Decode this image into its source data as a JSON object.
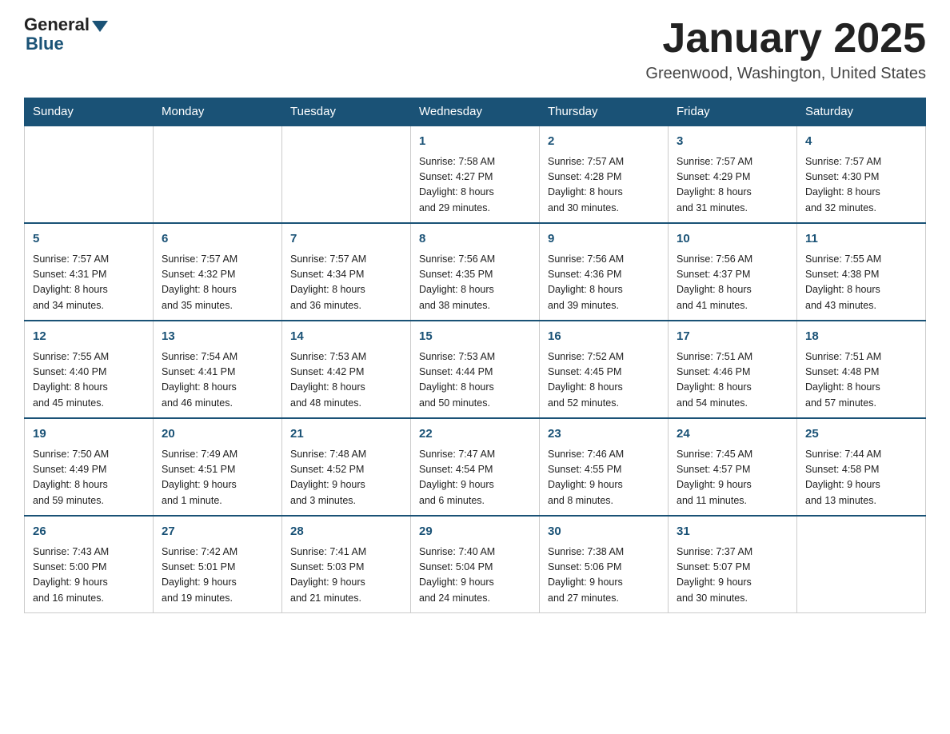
{
  "header": {
    "logo_general": "General",
    "logo_blue": "Blue",
    "title": "January 2025",
    "location": "Greenwood, Washington, United States"
  },
  "days_of_week": [
    "Sunday",
    "Monday",
    "Tuesday",
    "Wednesday",
    "Thursday",
    "Friday",
    "Saturday"
  ],
  "weeks": [
    [
      {
        "day": "",
        "info": ""
      },
      {
        "day": "",
        "info": ""
      },
      {
        "day": "",
        "info": ""
      },
      {
        "day": "1",
        "info": "Sunrise: 7:58 AM\nSunset: 4:27 PM\nDaylight: 8 hours\nand 29 minutes."
      },
      {
        "day": "2",
        "info": "Sunrise: 7:57 AM\nSunset: 4:28 PM\nDaylight: 8 hours\nand 30 minutes."
      },
      {
        "day": "3",
        "info": "Sunrise: 7:57 AM\nSunset: 4:29 PM\nDaylight: 8 hours\nand 31 minutes."
      },
      {
        "day": "4",
        "info": "Sunrise: 7:57 AM\nSunset: 4:30 PM\nDaylight: 8 hours\nand 32 minutes."
      }
    ],
    [
      {
        "day": "5",
        "info": "Sunrise: 7:57 AM\nSunset: 4:31 PM\nDaylight: 8 hours\nand 34 minutes."
      },
      {
        "day": "6",
        "info": "Sunrise: 7:57 AM\nSunset: 4:32 PM\nDaylight: 8 hours\nand 35 minutes."
      },
      {
        "day": "7",
        "info": "Sunrise: 7:57 AM\nSunset: 4:34 PM\nDaylight: 8 hours\nand 36 minutes."
      },
      {
        "day": "8",
        "info": "Sunrise: 7:56 AM\nSunset: 4:35 PM\nDaylight: 8 hours\nand 38 minutes."
      },
      {
        "day": "9",
        "info": "Sunrise: 7:56 AM\nSunset: 4:36 PM\nDaylight: 8 hours\nand 39 minutes."
      },
      {
        "day": "10",
        "info": "Sunrise: 7:56 AM\nSunset: 4:37 PM\nDaylight: 8 hours\nand 41 minutes."
      },
      {
        "day": "11",
        "info": "Sunrise: 7:55 AM\nSunset: 4:38 PM\nDaylight: 8 hours\nand 43 minutes."
      }
    ],
    [
      {
        "day": "12",
        "info": "Sunrise: 7:55 AM\nSunset: 4:40 PM\nDaylight: 8 hours\nand 45 minutes."
      },
      {
        "day": "13",
        "info": "Sunrise: 7:54 AM\nSunset: 4:41 PM\nDaylight: 8 hours\nand 46 minutes."
      },
      {
        "day": "14",
        "info": "Sunrise: 7:53 AM\nSunset: 4:42 PM\nDaylight: 8 hours\nand 48 minutes."
      },
      {
        "day": "15",
        "info": "Sunrise: 7:53 AM\nSunset: 4:44 PM\nDaylight: 8 hours\nand 50 minutes."
      },
      {
        "day": "16",
        "info": "Sunrise: 7:52 AM\nSunset: 4:45 PM\nDaylight: 8 hours\nand 52 minutes."
      },
      {
        "day": "17",
        "info": "Sunrise: 7:51 AM\nSunset: 4:46 PM\nDaylight: 8 hours\nand 54 minutes."
      },
      {
        "day": "18",
        "info": "Sunrise: 7:51 AM\nSunset: 4:48 PM\nDaylight: 8 hours\nand 57 minutes."
      }
    ],
    [
      {
        "day": "19",
        "info": "Sunrise: 7:50 AM\nSunset: 4:49 PM\nDaylight: 8 hours\nand 59 minutes."
      },
      {
        "day": "20",
        "info": "Sunrise: 7:49 AM\nSunset: 4:51 PM\nDaylight: 9 hours\nand 1 minute."
      },
      {
        "day": "21",
        "info": "Sunrise: 7:48 AM\nSunset: 4:52 PM\nDaylight: 9 hours\nand 3 minutes."
      },
      {
        "day": "22",
        "info": "Sunrise: 7:47 AM\nSunset: 4:54 PM\nDaylight: 9 hours\nand 6 minutes."
      },
      {
        "day": "23",
        "info": "Sunrise: 7:46 AM\nSunset: 4:55 PM\nDaylight: 9 hours\nand 8 minutes."
      },
      {
        "day": "24",
        "info": "Sunrise: 7:45 AM\nSunset: 4:57 PM\nDaylight: 9 hours\nand 11 minutes."
      },
      {
        "day": "25",
        "info": "Sunrise: 7:44 AM\nSunset: 4:58 PM\nDaylight: 9 hours\nand 13 minutes."
      }
    ],
    [
      {
        "day": "26",
        "info": "Sunrise: 7:43 AM\nSunset: 5:00 PM\nDaylight: 9 hours\nand 16 minutes."
      },
      {
        "day": "27",
        "info": "Sunrise: 7:42 AM\nSunset: 5:01 PM\nDaylight: 9 hours\nand 19 minutes."
      },
      {
        "day": "28",
        "info": "Sunrise: 7:41 AM\nSunset: 5:03 PM\nDaylight: 9 hours\nand 21 minutes."
      },
      {
        "day": "29",
        "info": "Sunrise: 7:40 AM\nSunset: 5:04 PM\nDaylight: 9 hours\nand 24 minutes."
      },
      {
        "day": "30",
        "info": "Sunrise: 7:38 AM\nSunset: 5:06 PM\nDaylight: 9 hours\nand 27 minutes."
      },
      {
        "day": "31",
        "info": "Sunrise: 7:37 AM\nSunset: 5:07 PM\nDaylight: 9 hours\nand 30 minutes."
      },
      {
        "day": "",
        "info": ""
      }
    ]
  ]
}
